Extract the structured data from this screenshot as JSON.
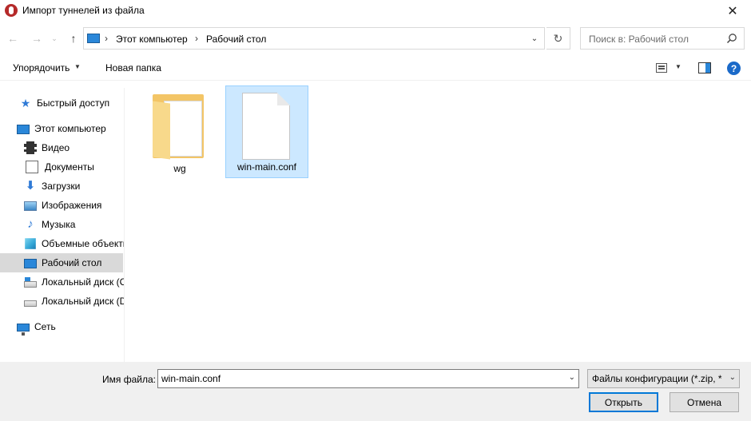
{
  "window": {
    "title": "Импорт туннелей из файла",
    "close_glyph": "✕"
  },
  "nav": {
    "back_glyph": "←",
    "forward_glyph": "→",
    "recent_glyph": "⌄",
    "up_glyph": "↑",
    "breadcrumbs": [
      "Этот компьютер",
      "Рабочий стол"
    ],
    "separator": "›",
    "refresh_glyph": "↻",
    "dropdown_glyph": "⌄",
    "search_placeholder": "Поиск в: Рабочий стол"
  },
  "toolbar": {
    "organize_label": "Упорядочить",
    "organize_caret": "▼",
    "new_folder_label": "Новая папка",
    "view_caret": "▼",
    "help_glyph": "?"
  },
  "sidebar": {
    "items": [
      {
        "label": "Быстрый доступ",
        "icon": "star-icon"
      },
      {
        "label": "Этот компьютер",
        "icon": "computer-icon"
      },
      {
        "label": "Видео",
        "icon": "video-icon"
      },
      {
        "label": "Документы",
        "icon": "documents-icon"
      },
      {
        "label": "Загрузки",
        "icon": "downloads-icon"
      },
      {
        "label": "Изображения",
        "icon": "pictures-icon"
      },
      {
        "label": "Музыка",
        "icon": "music-icon"
      },
      {
        "label": "Объемные объекты",
        "icon": "3d-objects-icon"
      },
      {
        "label": "Рабочий стол",
        "icon": "desktop-icon",
        "selected": true
      },
      {
        "label": "Локальный диск (C:)",
        "icon": "drive-c-icon"
      },
      {
        "label": "Локальный диск (D:)",
        "icon": "drive-d-icon"
      },
      {
        "label": "Сеть",
        "icon": "network-icon"
      }
    ]
  },
  "files": [
    {
      "name": "wg",
      "type": "folder",
      "icon": "folder-icon"
    },
    {
      "name": "win-main.conf",
      "type": "file",
      "icon": "file-icon",
      "selected": true
    }
  ],
  "footer": {
    "filename_label": "Имя файла:",
    "filename_value": "win-main.conf",
    "filetype_value": "Файлы конфигурации (*.zip, *",
    "caret_glyph": "⌄",
    "open_label": "Открыть",
    "cancel_label": "Отмена"
  },
  "colors": {
    "selection": "#cce8ff",
    "accent": "#0078d7",
    "folder": "#f3c566"
  }
}
